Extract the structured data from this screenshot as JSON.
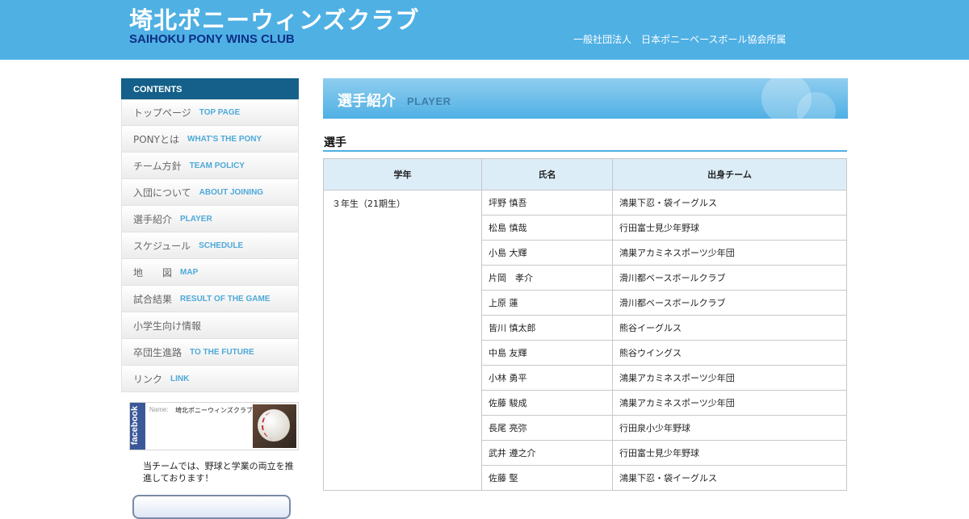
{
  "header": {
    "title_jp": "埼北ポニーウィンズクラブ",
    "title_en": "SAIHOKU PONY WINS CLUB",
    "org": "一般社団法人　日本ポニーベースボール協会所属"
  },
  "sidebar": {
    "contents_label": "CONTENTS",
    "items": [
      {
        "jp": "トップページ",
        "en": "TOP PAGE"
      },
      {
        "jp": "PONYとは",
        "en": "WHAT'S THE PONY"
      },
      {
        "jp": "チーム方針",
        "en": "TEAM POLICY"
      },
      {
        "jp": "入団について",
        "en": "ABOUT JOINING"
      },
      {
        "jp": "選手紹介",
        "en": "PLAYER"
      },
      {
        "jp": "スケジュール",
        "en": "SCHEDULE"
      },
      {
        "jp": "地　　図",
        "en": "MAP"
      },
      {
        "jp": "試合結果",
        "en": "RESULT OF THE GAME"
      },
      {
        "jp": "小学生向け情報",
        "en": ""
      },
      {
        "jp": "卒団生進路",
        "en": "TO THE FUTURE"
      },
      {
        "jp": "リンク",
        "en": "LINK"
      }
    ],
    "facebook": {
      "logo_text": "facebook",
      "name_label": "Name:",
      "name": "埼北ポニーウィンズクラブ"
    },
    "promo_text": "当チームでは、野球と学業の両立を推進しております！"
  },
  "main": {
    "page_title_jp": "選手紹介",
    "page_title_en": "PLAYER",
    "section_title": "選手",
    "table": {
      "headers": [
        "学年",
        "氏名",
        "出身チーム"
      ],
      "grade": "３年生（21期生）",
      "rows": [
        {
          "name": "坪野 慎吾",
          "team": "鴻巣下忍・袋イーグルス"
        },
        {
          "name": "松島 慎哉",
          "team": "行田富士見少年野球"
        },
        {
          "name": "小島 大輝",
          "team": "鴻巣アカミネスポーツ少年団"
        },
        {
          "name": "片岡　孝介",
          "team": "滑川都ベースボールクラブ"
        },
        {
          "name": "上原 蓮",
          "team": "滑川都ベースボールクラブ"
        },
        {
          "name": "皆川 慎太郎",
          "team": "熊谷イーグルス"
        },
        {
          "name": "中島 友輝",
          "team": "熊谷ウイングス"
        },
        {
          "name": "小林 勇平",
          "team": "鴻巣アカミネスポーツ少年団"
        },
        {
          "name": "佐藤 駿成",
          "team": "鴻巣アカミネスポーツ少年団"
        },
        {
          "name": "長尾 亮弥",
          "team": "行田泉小少年野球"
        },
        {
          "name": "武井 遵之介",
          "team": "行田富士見少年野球"
        },
        {
          "name": "佐藤 堅",
          "team": "鴻巣下忍・袋イーグルス"
        }
      ]
    }
  },
  "colors": {
    "header_bg": "#4fb0e4",
    "subtitle": "#0c2f86",
    "contents_bg": "#14608a",
    "nav_en": "#4ea9d9",
    "table_head_bg": "#dcedf8"
  }
}
